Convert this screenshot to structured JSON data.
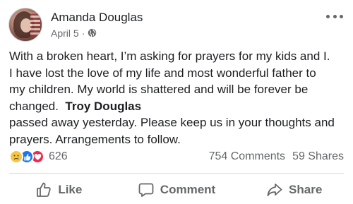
{
  "post": {
    "author": "Amanda Douglas",
    "date": "April 5",
    "separator": "·",
    "privacy_icon": "globe-icon",
    "more_icon": "ellipsis-icon",
    "body_lines": {
      "l1": "With a broken heart, I’m asking for prayers for my kids and I.",
      "l2": "I have lost the love of my life and most wonderful father to",
      "l3": "my children. My world is shattered and will be forever be",
      "l4_pre": "changed.  ",
      "l4_name": "Troy Douglas",
      "l5": "passed away yesterday. Please keep us in your thoughts and",
      "l6": "prayers. Arrangements to follow."
    }
  },
  "stats": {
    "reaction_icons": [
      "sad-reaction-icon",
      "like-reaction-icon",
      "love-reaction-icon"
    ],
    "reaction_count": "626",
    "comments": "754 Comments",
    "shares": "59 Shares"
  },
  "actions": {
    "like_label": "Like",
    "comment_label": "Comment",
    "share_label": "Share"
  },
  "colors": {
    "text": "#1c1e21",
    "secondary": "#65676b",
    "like_blue": "#1877f2",
    "love_red": "#f0284a",
    "sad_yellow": "#f7c542"
  }
}
